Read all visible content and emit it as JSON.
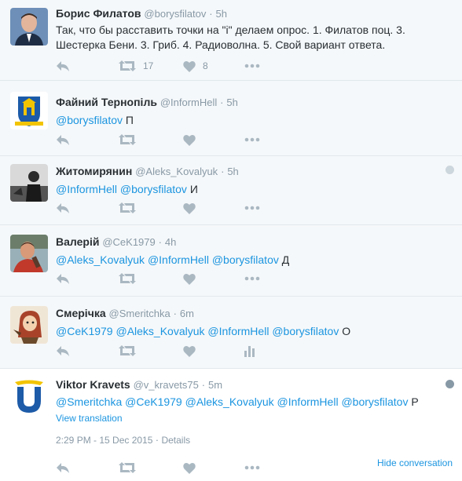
{
  "tweets": [
    {
      "name": "Борис Филатов",
      "handle": "@borysfilatov",
      "sep": "·",
      "time": "5h",
      "text": "Так, что бы расставить точки на \"і\" делаем опрос. 1. Филатов поц. 3. Шестерка Бени. 3. Гриб. 4. Радиоволна. 5. Свой вариант ответа.",
      "retweets": "17",
      "likes": "8"
    },
    {
      "name": "Файний Тернопіль",
      "handle": "@InformHell",
      "sep": "·",
      "time": "5h",
      "mentions": [
        "@borysfilatov"
      ],
      "text": "П"
    },
    {
      "name": "Житомирянин",
      "handle": "@Aleks_Kovalyuk",
      "sep": "·",
      "time": "5h",
      "mentions": [
        "@InformHell",
        "@borysfilatov"
      ],
      "text": "И"
    },
    {
      "name": "Валерій",
      "handle": "@CeK1979",
      "sep": "·",
      "time": "4h",
      "mentions": [
        "@Aleks_Kovalyuk",
        "@InformHell",
        "@borysfilatov"
      ],
      "text": "Д"
    },
    {
      "name": "Смерічка",
      "handle": "@Smeritchka",
      "sep": "·",
      "time": "6m",
      "mentions": [
        "@CeK1979",
        "@Aleks_Kovalyuk",
        "@InformHell",
        "@borysfilatov"
      ],
      "text": "О"
    },
    {
      "name": "Viktor Kravets",
      "handle": "@v_kravets75",
      "sep": "·",
      "time": "5m",
      "mentions": [
        "@Smeritchka",
        "@CeK1979",
        "@Aleks_Kovalyuk",
        "@InformHell",
        "@borysfilatov"
      ],
      "text": "Р",
      "translate": "View translation",
      "timestamp": "2:29 PM - 15 Dec 2015",
      "details": "Details",
      "hide": "Hide conversation"
    }
  ],
  "icons": [
    "reply-icon",
    "retweet-icon",
    "like-icon",
    "more-icon",
    "analytics-icon",
    "globe-icon"
  ],
  "colors": {
    "link": "#1b95e0",
    "muted": "#8899a6",
    "icon": "#aab8c2",
    "bg": "#f5f8fa",
    "border": "#e1e8ed"
  }
}
